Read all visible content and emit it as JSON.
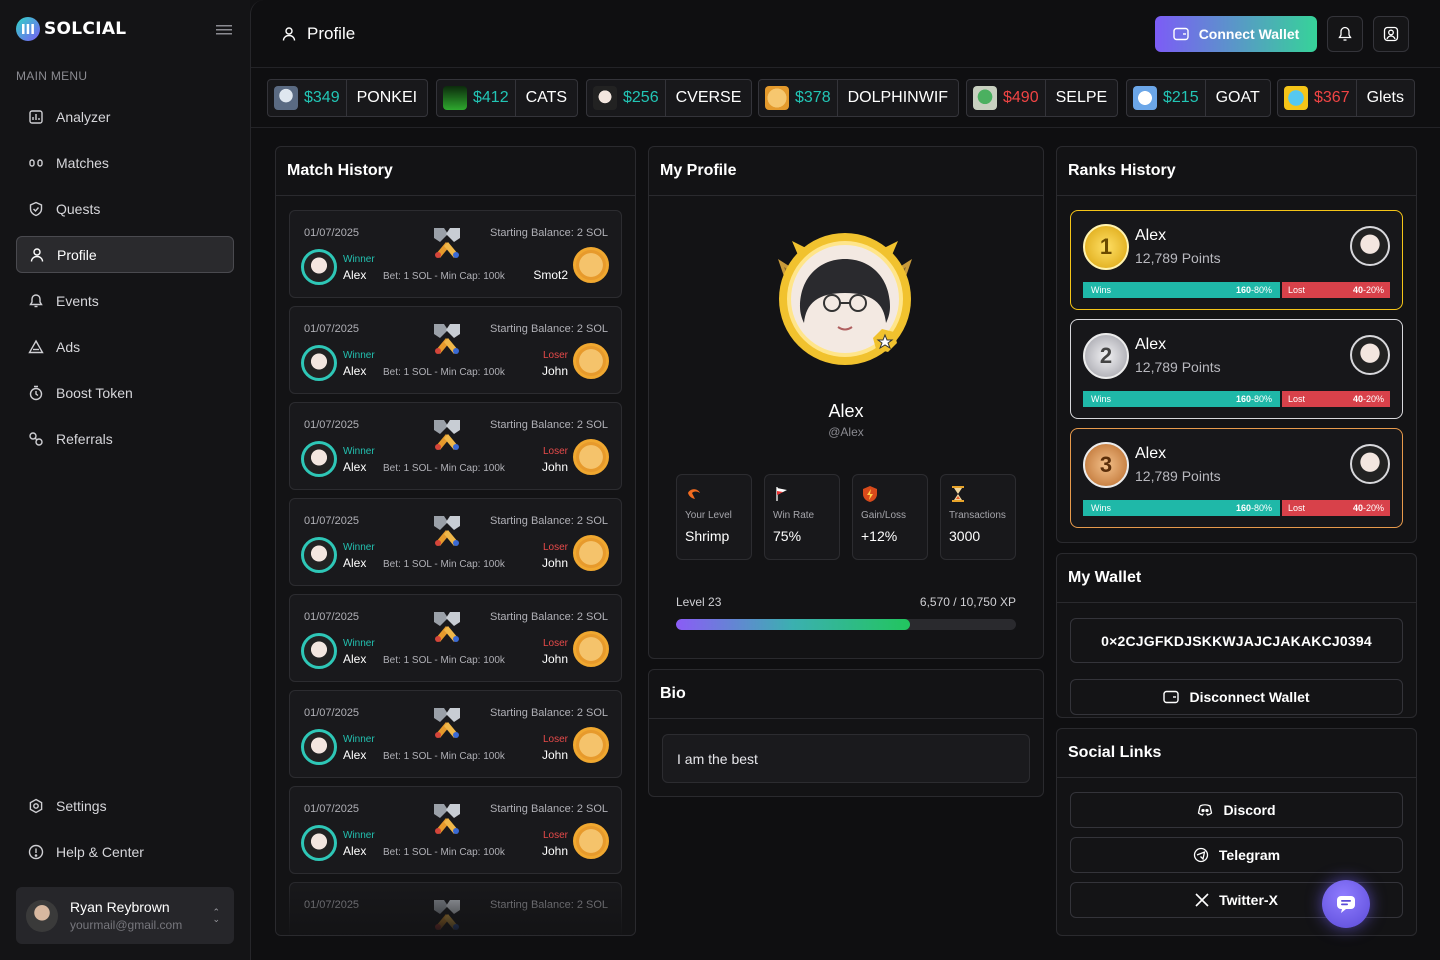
{
  "app": {
    "brand": "SOLCIAL"
  },
  "sidebar": {
    "section_title": "MAIN MENU",
    "items": [
      {
        "label": "Analyzer",
        "icon": "analyzer-icon"
      },
      {
        "label": "Matches",
        "icon": "matches-icon"
      },
      {
        "label": "Quests",
        "icon": "quests-icon"
      },
      {
        "label": "Profile",
        "icon": "user-icon",
        "active": true
      },
      {
        "label": "Events",
        "icon": "events-icon"
      },
      {
        "label": "Ads",
        "icon": "ads-icon"
      },
      {
        "label": "Boost Token",
        "icon": "boost-icon"
      },
      {
        "label": "Referrals",
        "icon": "referrals-icon"
      }
    ],
    "bottom_items": [
      {
        "label": "Settings",
        "icon": "gear-icon"
      },
      {
        "label": "Help & Center",
        "icon": "help-icon"
      }
    ],
    "user": {
      "name": "Ryan Reybrown",
      "email": "yourmail@gmail.com"
    }
  },
  "header": {
    "title": "Profile",
    "connect_label": "Connect Wallet"
  },
  "tickers": [
    {
      "price": "$349",
      "name": "PONKEI",
      "color": "#22c5b5"
    },
    {
      "price": "$412",
      "name": "CATS",
      "color": "#22c5b5"
    },
    {
      "price": "$256",
      "name": "CVERSE",
      "color": "#22c5b5"
    },
    {
      "price": "$378",
      "name": "DOLPHINWIF",
      "color": "#22c5b5"
    },
    {
      "price": "$490",
      "name": "SELPE",
      "color": "#ef4444"
    },
    {
      "price": "$215",
      "name": "GOAT",
      "color": "#22c5b5"
    },
    {
      "price": "$367",
      "name": "Glets",
      "color": "#ef4444"
    }
  ],
  "match_history": {
    "title": "Match History",
    "matches": [
      {
        "date": "01/07/2025",
        "balance": "Starting Balance: 2 SOL",
        "winner_label": "Winner",
        "winner": "Alex",
        "bet": "Bet: 1 SOL",
        "cap": "Min Cap: 100k",
        "loser_label": "",
        "loser": "Smot2"
      },
      {
        "date": "01/07/2025",
        "balance": "Starting Balance: 2 SOL",
        "winner_label": "Winner",
        "winner": "Alex",
        "bet": "Bet: 1 SOL",
        "cap": "Min Cap: 100k",
        "loser_label": "Loser",
        "loser": "John"
      },
      {
        "date": "01/07/2025",
        "balance": "Starting Balance: 2 SOL",
        "winner_label": "Winner",
        "winner": "Alex",
        "bet": "Bet: 1 SOL",
        "cap": "Min Cap: 100k",
        "loser_label": "Loser",
        "loser": "John"
      },
      {
        "date": "01/07/2025",
        "balance": "Starting Balance: 2 SOL",
        "winner_label": "Winner",
        "winner": "Alex",
        "bet": "Bet: 1 SOL",
        "cap": "Min Cap: 100k",
        "loser_label": "Loser",
        "loser": "John"
      },
      {
        "date": "01/07/2025",
        "balance": "Starting Balance: 2 SOL",
        "winner_label": "Winner",
        "winner": "Alex",
        "bet": "Bet: 1 SOL",
        "cap": "Min Cap: 100k",
        "loser_label": "Loser",
        "loser": "John"
      },
      {
        "date": "01/07/2025",
        "balance": "Starting Balance: 2 SOL",
        "winner_label": "Winner",
        "winner": "Alex",
        "bet": "Bet: 1 SOL",
        "cap": "Min Cap: 100k",
        "loser_label": "Loser",
        "loser": "John"
      },
      {
        "date": "01/07/2025",
        "balance": "Starting Balance: 2 SOL",
        "winner_label": "Winner",
        "winner": "Alex",
        "bet": "Bet: 1 SOL",
        "cap": "Min Cap: 100k",
        "loser_label": "Loser",
        "loser": "John"
      },
      {
        "date": "01/07/2025",
        "balance": "Starting Balance: 2 SOL",
        "winner_label": "",
        "winner": "",
        "bet": "",
        "cap": "",
        "loser_label": "",
        "loser": ""
      }
    ]
  },
  "my_profile": {
    "title": "My Profile",
    "name": "Alex",
    "handle": "@Alex",
    "stats": [
      {
        "label": "Your Level",
        "value": "Shrimp",
        "icon": "shrimp-icon"
      },
      {
        "label": "Win Rate",
        "value": "75%",
        "icon": "flag-icon"
      },
      {
        "label": "Gain/Loss",
        "value": "+12%",
        "icon": "shield-bolt-icon"
      },
      {
        "label": "Transactions",
        "value": "3000",
        "icon": "hourglass-icon"
      }
    ],
    "level_label": "Level 23",
    "xp_label": "6,570 / 10,750 XP",
    "xp_fraction": 0.688
  },
  "bio": {
    "title": "Bio",
    "text": "I am the best"
  },
  "ranks": {
    "title": "Ranks History",
    "items": [
      {
        "rank": "1",
        "name": "Alex",
        "points": "12,789 Points",
        "wins_label": "Wins",
        "wins": "160",
        "wins_pct": "80%",
        "lost_label": "Lost",
        "lost": "40",
        "lost_pct": "20%",
        "color": "#f5c518"
      },
      {
        "rank": "2",
        "name": "Alex",
        "points": "12,789 Points",
        "wins_label": "Wins",
        "wins": "160",
        "wins_pct": "80%",
        "lost_label": "Lost",
        "lost": "40",
        "lost_pct": "20%",
        "color": "#d8d8dc"
      },
      {
        "rank": "3",
        "name": "Alex",
        "points": "12,789 Points",
        "wins_label": "Wins",
        "wins": "160",
        "wins_pct": "80%",
        "lost_label": "Lost",
        "lost": "40",
        "lost_pct": "20%",
        "color": "#e79a4c"
      }
    ]
  },
  "wallet": {
    "title": "My Wallet",
    "address": "0×2CJGFKDJSKKWJAJCJAKAKCJ0394",
    "disconnect_label": "Disconnect Wallet"
  },
  "social": {
    "title": "Social Links",
    "links": [
      {
        "label": "Discord",
        "icon": "discord-icon"
      },
      {
        "label": "Telegram",
        "icon": "telegram-icon"
      },
      {
        "label": "Twitter-X",
        "icon": "x-icon"
      }
    ]
  }
}
